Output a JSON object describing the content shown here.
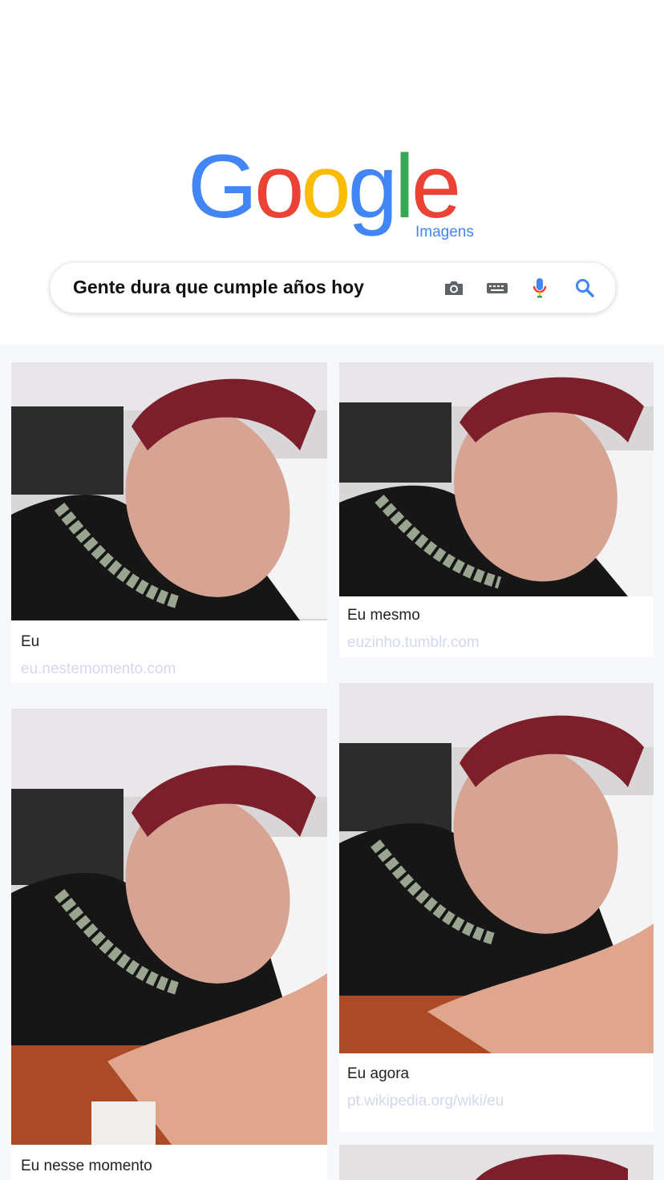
{
  "logo": {
    "letters": [
      "G",
      "o",
      "o",
      "g",
      "l",
      "e"
    ],
    "colors": [
      "#4285F4",
      "#EA4335",
      "#FBBC05",
      "#4285F4",
      "#34A853",
      "#EA4335"
    ],
    "subtitle": "Imagens"
  },
  "search": {
    "query": "Gente dura que cumple años hoy",
    "icons": [
      "camera-icon",
      "keyboard-icon",
      "mic-icon",
      "search-icon"
    ]
  },
  "results": [
    {
      "caption": "Eu",
      "source": "eu.nestemomento.com"
    },
    {
      "caption": "Eu mesmo",
      "source": "euzinho.tumblr.com"
    },
    {
      "caption": "Eu nesse momento",
      "source": ""
    },
    {
      "caption": "Eu agora",
      "source": "pt.wikipedia.org/wiki/eu"
    }
  ]
}
